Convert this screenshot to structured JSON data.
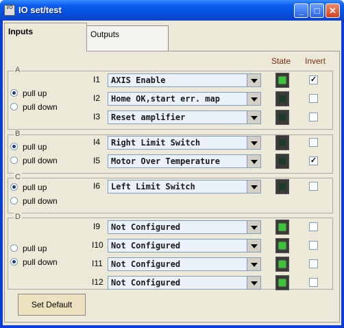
{
  "window": {
    "title": "IO set/test",
    "icon_label": "I/O",
    "controls": {
      "minimize": "_",
      "maximize": "□",
      "close": "✕"
    }
  },
  "tabs": [
    {
      "label": "Inputs",
      "active": true
    },
    {
      "label": "Outputs",
      "active": false
    }
  ],
  "columns": {
    "state": "State",
    "invert": "Invert"
  },
  "groups": [
    {
      "label": "A",
      "pull_up": "pull up",
      "pull_down": "pull down",
      "selected": "pull up",
      "inputs": [
        {
          "id": "I1",
          "function": "AXIS Enable",
          "state": "on",
          "invert": true
        },
        {
          "id": "I2",
          "function": "Home OK,start err. map",
          "state": "off",
          "invert": false
        },
        {
          "id": "I3",
          "function": "Reset amplifier",
          "state": "off",
          "invert": false
        }
      ]
    },
    {
      "label": "B",
      "pull_up": "pull up",
      "pull_down": "pull down",
      "selected": "pull up",
      "inputs": [
        {
          "id": "I4",
          "function": "Right Limit Switch",
          "state": "off",
          "invert": false
        },
        {
          "id": "I5",
          "function": "Motor Over Temperature",
          "state": "off",
          "invert": true
        }
      ]
    },
    {
      "label": "C",
      "pull_up": "pull up",
      "pull_down": "pull down",
      "selected": "pull up",
      "inputs": [
        {
          "id": "I6",
          "function": "Left Limit Switch",
          "state": "off",
          "invert": false
        }
      ]
    },
    {
      "label": "D",
      "pull_up": "pull up",
      "pull_down": "pull down",
      "selected": "pull down",
      "inputs": [
        {
          "id": "I9",
          "function": "Not Configured",
          "state": "on",
          "invert": false
        },
        {
          "id": "I10",
          "function": "Not Configured",
          "state": "on",
          "invert": false
        },
        {
          "id": "I11",
          "function": "Not Configured",
          "state": "on",
          "invert": false
        },
        {
          "id": "I12",
          "function": "Not Configured",
          "state": "on",
          "invert": false
        }
      ]
    }
  ],
  "buttons": {
    "set_default": "Set Default"
  },
  "colors": {
    "led_on": "#3ec43a",
    "led_off": "#1e3a2a",
    "header_text": "#7a2a10"
  }
}
